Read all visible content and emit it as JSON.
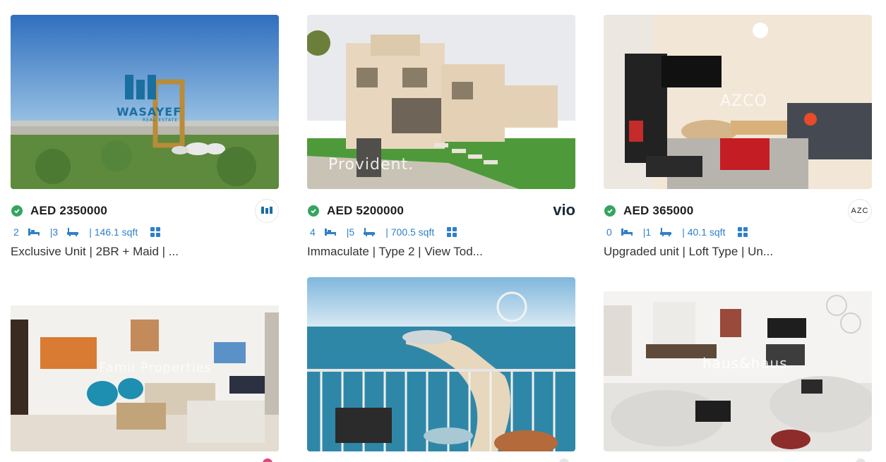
{
  "listings": [
    {
      "price": "AED 2350000",
      "beds": "2",
      "baths": "|3",
      "area": "| 146.1 sqft",
      "title": "Exclusive Unit | 2BR + Maid | ...",
      "agency_logo_text": "WASAYEF",
      "photo_watermark": "WASAYEF",
      "photo_watermark_sub": "REAL ESTATE"
    },
    {
      "price": "AED 5200000",
      "beds": "4",
      "baths": "|5",
      "area": "| 700.5 sqft",
      "title": "Immaculate | Type 2 | View Tod...",
      "agency_logo_text": "vio",
      "photo_watermark": "Provident."
    },
    {
      "price": "AED 365000",
      "beds": "0",
      "baths": "|1",
      "area": "| 40.1 sqft",
      "title": "Upgraded unit | Loft Type | Un...",
      "agency_logo_text": "AZC",
      "photo_watermark": "AZCO"
    },
    {
      "photo_watermark": "Famil Properties"
    },
    {
      "photo_watermark": ""
    },
    {
      "photo_watermark": "haus&haus"
    }
  ],
  "colors": {
    "accent": "#2f80c9",
    "verified": "#35a55e",
    "price": "#1e1e1e"
  },
  "icons": [
    "verified-check-icon",
    "bed-icon",
    "bath-icon",
    "floor-plan-icon"
  ]
}
